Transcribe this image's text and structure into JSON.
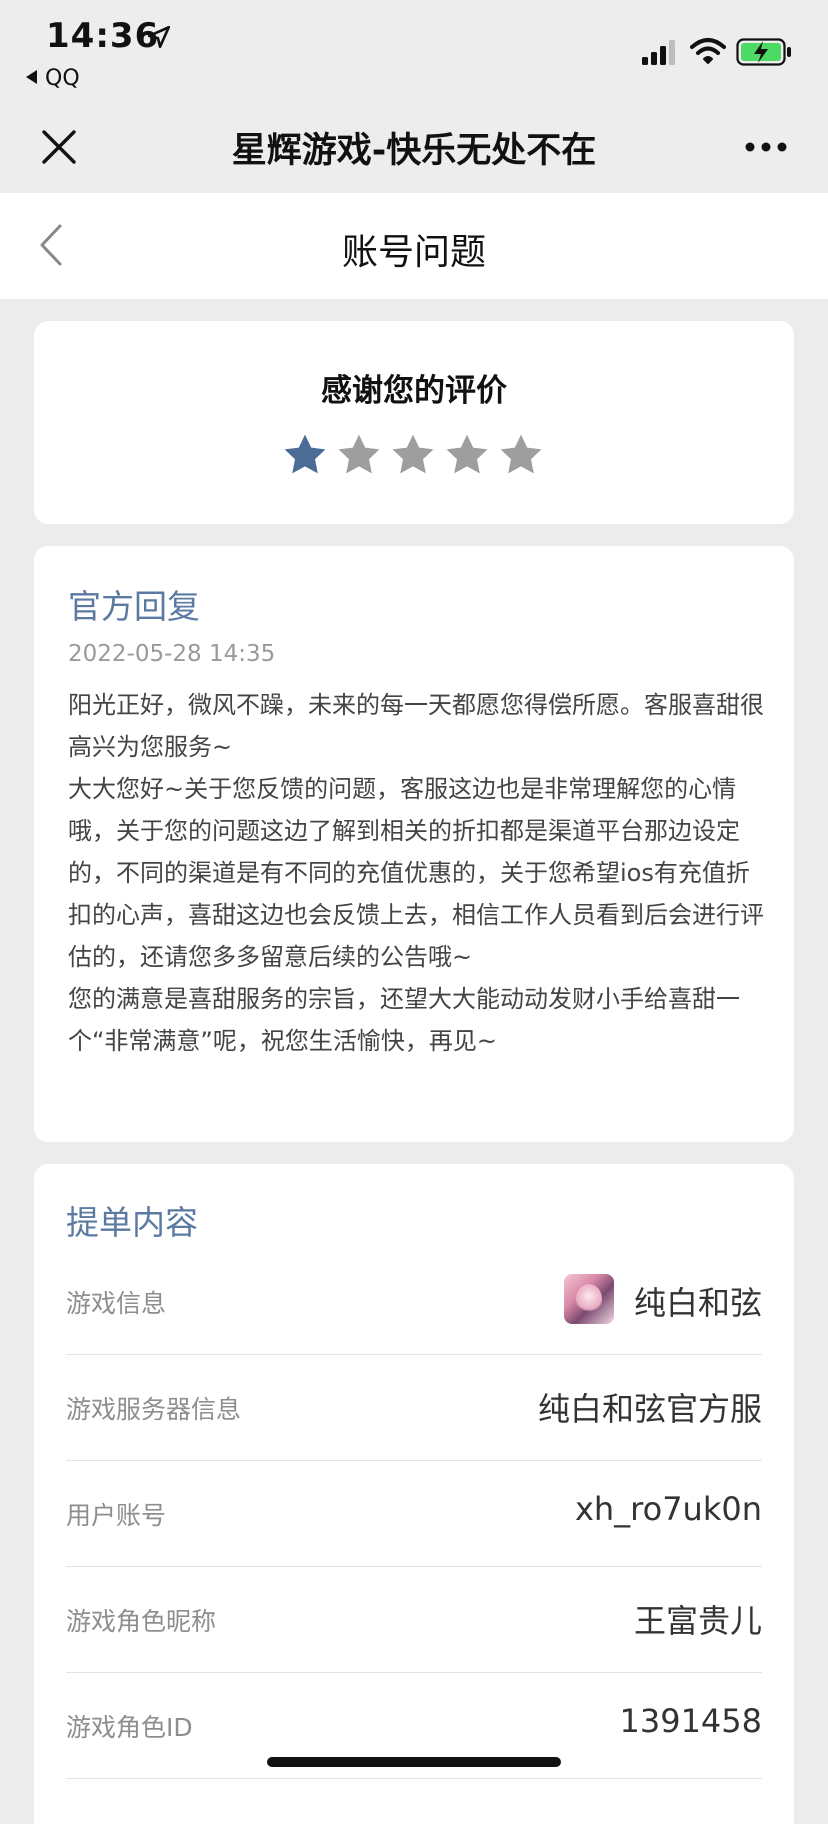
{
  "status_bar": {
    "time": "14:36",
    "back_app_label": "QQ",
    "icons": [
      "location-arrow-icon",
      "signal-icon",
      "wifi-icon",
      "battery-charging-icon"
    ]
  },
  "nav": {
    "title": "星辉游戏-快乐无处不在",
    "left_icon": "close-icon",
    "right_icon": "more-icon"
  },
  "header": {
    "title": "账号问题",
    "left_icon": "back-chevron-icon"
  },
  "rating": {
    "title": "感谢您的评价",
    "value": 1,
    "max": 5,
    "active_color": "#4a6c97",
    "inactive_color": "#9e9e9e"
  },
  "reply": {
    "title": "官方回复",
    "date": "2022-05-28 14:35",
    "paragraphs": [
      "阳光正好，微风不躁，未来的每一天都愿您得偿所愿。客服喜甜很高兴为您服务~",
      "大大您好~关于您反馈的问题，客服这边也是非常理解您的心情哦，关于您的问题这边了解到相关的折扣都是渠道平台那边设定的，不同的渠道是有不同的充值优惠的，关于您希望ios有充值折扣的心声，喜甜这边也会反馈上去，相信工作人员看到后会进行评估的，还请您多多留意后续的公告哦~",
      "您的满意是喜甜服务的宗旨，还望大大能动动发财小手给喜甜一个“非常满意”呢，祝您生活愉快，再见~"
    ]
  },
  "order": {
    "title": "提单内容",
    "rows": [
      {
        "label": "游戏信息",
        "value": "纯白和弦"
      },
      {
        "label": "游戏服务器信息",
        "value": "纯白和弦官方服"
      },
      {
        "label": "用户账号",
        "value": "xh_ro7uk0n"
      },
      {
        "label": "游戏角色昵称",
        "value": "王富贵儿"
      },
      {
        "label": "游戏角色ID",
        "value": "1391458"
      }
    ]
  },
  "colors": {
    "accent": "#5c79a2",
    "background": "#ececec"
  }
}
